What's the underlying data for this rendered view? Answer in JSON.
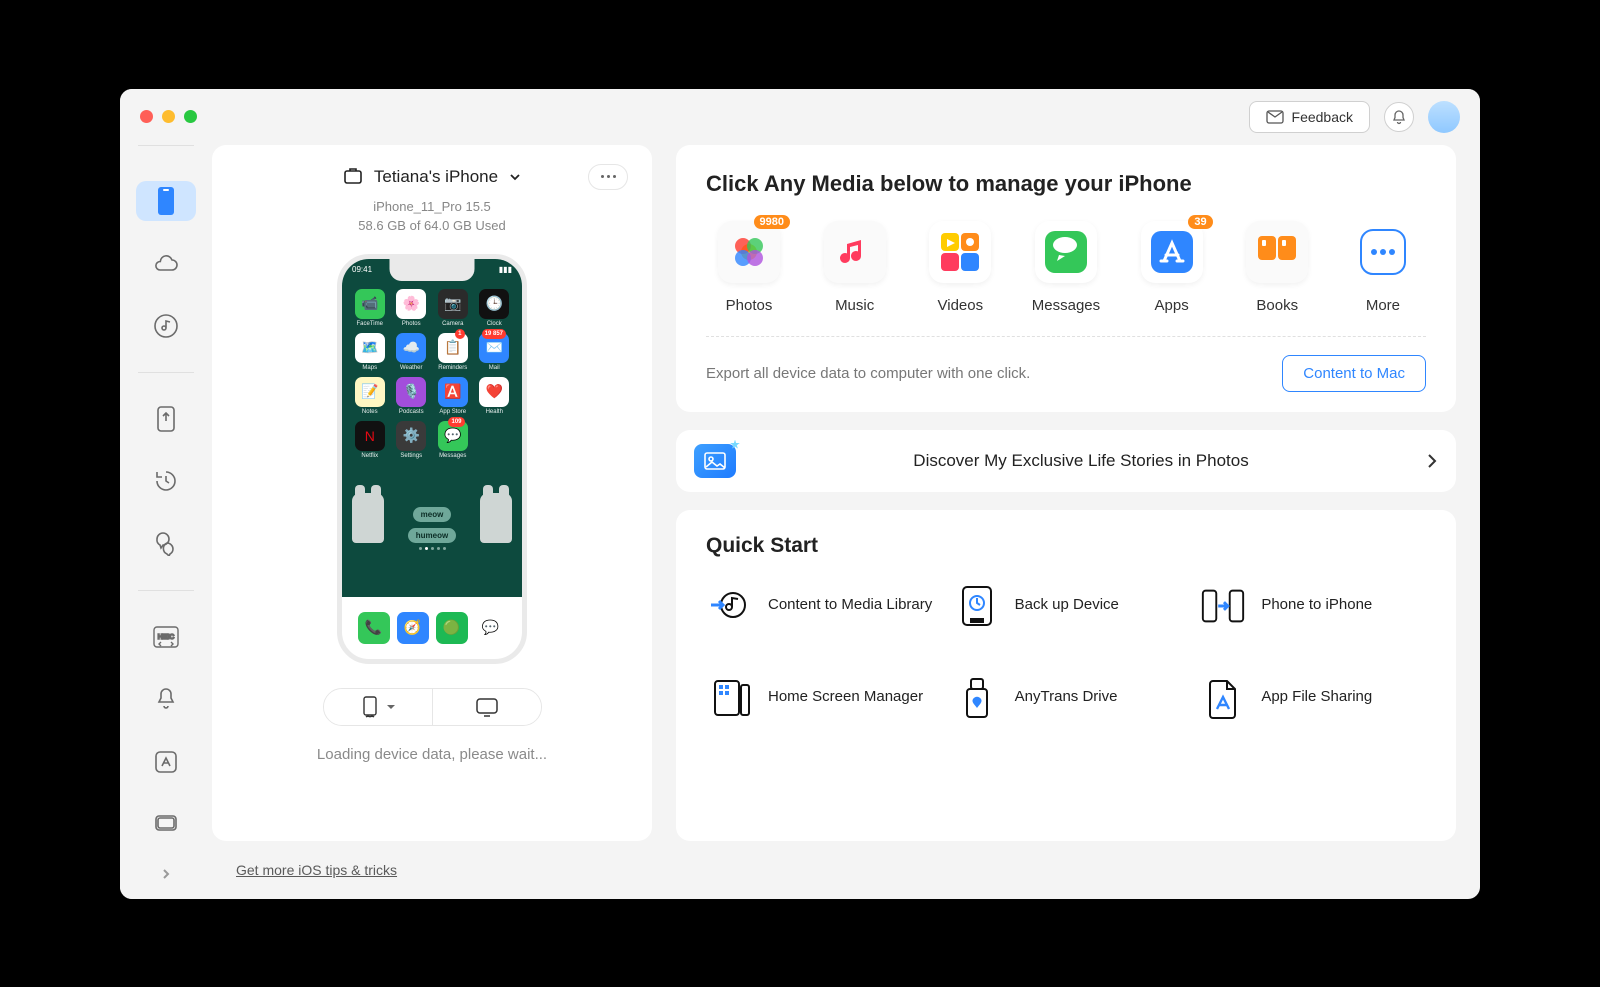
{
  "titlebar": {
    "feedback_label": "Feedback"
  },
  "device": {
    "name": "Tetiana's iPhone",
    "model_line": "iPhone_11_Pro 15.5",
    "storage_line": "58.6 GB of  64.0 GB Used",
    "status_line": "Loading device data, please wait...",
    "phone": {
      "time": "09:41",
      "bubbles": [
        "meow",
        "humeow"
      ],
      "apps_row1": [
        {
          "label": "FaceTime",
          "bg": "#34c759",
          "emoji": "📹"
        },
        {
          "label": "Photos",
          "bg": "#ffffff",
          "emoji": "🌸"
        },
        {
          "label": "Camera",
          "bg": "#2b2b2b",
          "emoji": "📷"
        },
        {
          "label": "Clock",
          "bg": "#111111",
          "emoji": "🕒"
        }
      ],
      "apps_row2": [
        {
          "label": "Maps",
          "bg": "#ffffff",
          "emoji": "🗺️"
        },
        {
          "label": "Weather",
          "bg": "#2f86ff",
          "emoji": "☁️"
        },
        {
          "label": "Reminders",
          "bg": "#ffffff",
          "emoji": "📋",
          "badge": "1"
        },
        {
          "label": "Mail",
          "bg": "#2f86ff",
          "emoji": "✉️",
          "badge": "19 857"
        }
      ],
      "apps_row3": [
        {
          "label": "Notes",
          "bg": "#fff7c2",
          "emoji": "📝"
        },
        {
          "label": "Podcasts",
          "bg": "#a24edb",
          "emoji": "🎙️"
        },
        {
          "label": "App Store",
          "bg": "#2f86ff",
          "emoji": "🅰️"
        },
        {
          "label": "Health",
          "bg": "#ffffff",
          "emoji": "❤️"
        }
      ],
      "apps_row4": [
        {
          "label": "Netflix",
          "bg": "#111111",
          "emoji": "N",
          "fg": "#e50914"
        },
        {
          "label": "Settings",
          "bg": "#3a3a3a",
          "emoji": "⚙️"
        },
        {
          "label": "Messages",
          "bg": "#34c759",
          "emoji": "💬",
          "badge": "109"
        }
      ],
      "dock": [
        {
          "bg": "#34c759",
          "emoji": "📞"
        },
        {
          "bg": "#2f86ff",
          "emoji": "🧭"
        },
        {
          "bg": "#1db954",
          "emoji": "🟢"
        },
        {
          "bg": "#ffffff",
          "emoji": "💬"
        }
      ]
    }
  },
  "media": {
    "heading": "Click Any Media below to manage your iPhone",
    "items": [
      {
        "label": "Photos",
        "badge": "9980"
      },
      {
        "label": "Music"
      },
      {
        "label": "Videos"
      },
      {
        "label": "Messages"
      },
      {
        "label": "Apps",
        "badge": "39"
      },
      {
        "label": "Books"
      },
      {
        "label": "More"
      }
    ],
    "export_text": "Export all device data to computer with one click.",
    "export_btn": "Content to Mac"
  },
  "promo": {
    "text": "Discover My Exclusive Life Stories in Photos"
  },
  "quickstart": {
    "heading": "Quick Start",
    "items": [
      "Content to Media Library",
      "Back up Device",
      "Phone to iPhone",
      "Home Screen Manager",
      "AnyTrans Drive",
      "App File Sharing"
    ]
  },
  "footer": {
    "link": "Get more iOS tips & tricks"
  }
}
